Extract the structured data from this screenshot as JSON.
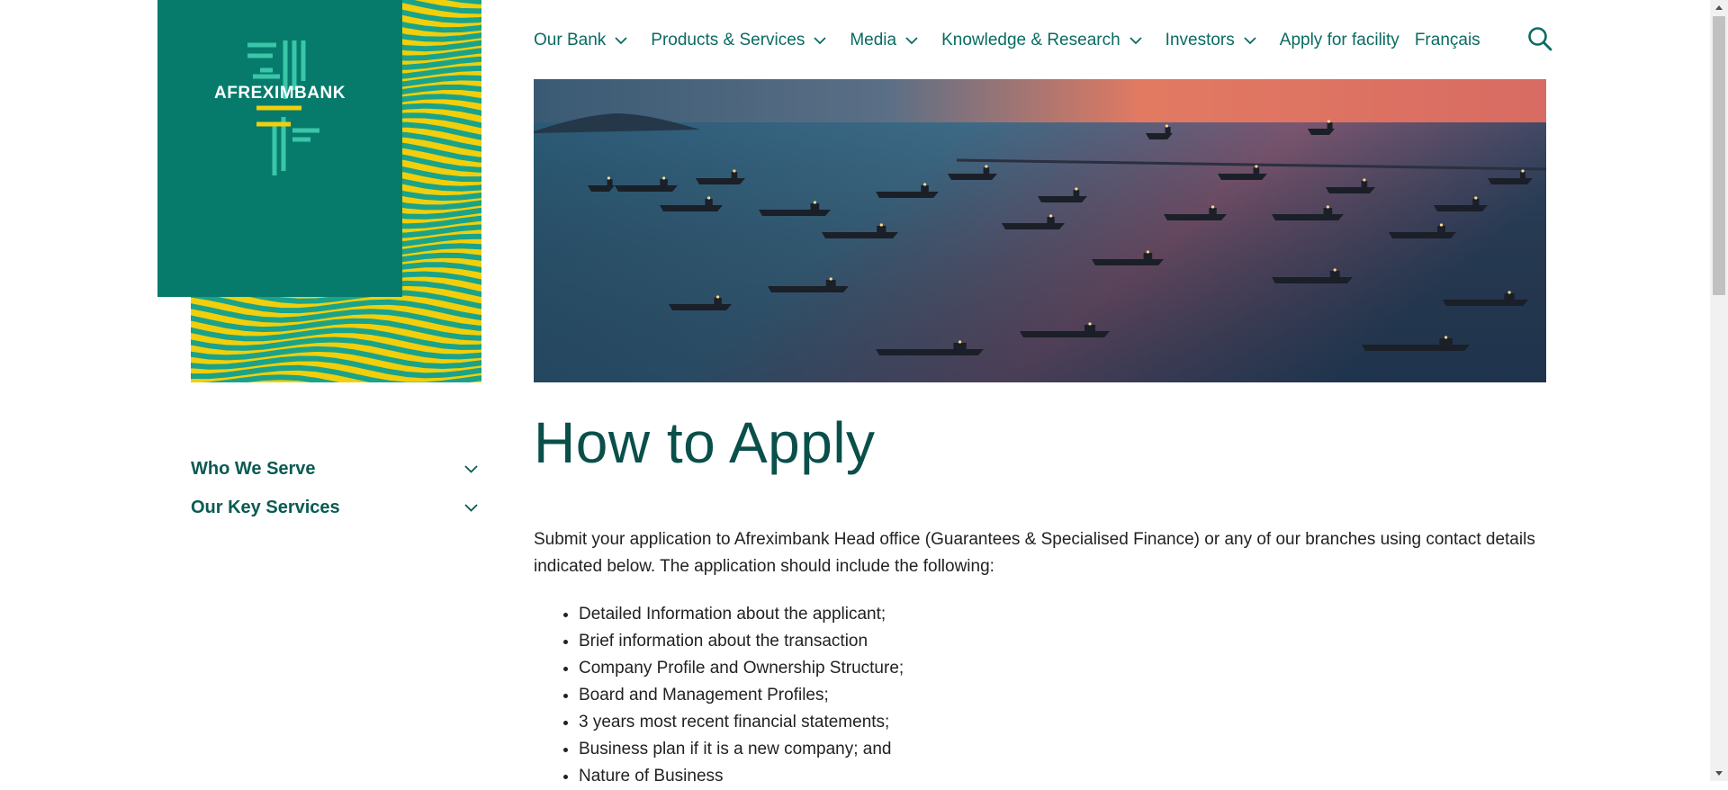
{
  "brand": {
    "name": "AFREXIMBANK"
  },
  "nav": {
    "items": [
      {
        "label": "Our Bank",
        "dropdown": true
      },
      {
        "label": "Products & Services",
        "dropdown": true
      },
      {
        "label": "Media",
        "dropdown": true
      },
      {
        "label": "Knowledge & Research",
        "dropdown": true
      },
      {
        "label": "Investors",
        "dropdown": true
      },
      {
        "label": "Apply for facility",
        "dropdown": false
      },
      {
        "label": "Français",
        "dropdown": false
      }
    ],
    "search_icon": "search-icon"
  },
  "sidebar": {
    "items": [
      {
        "label": "Who We Serve"
      },
      {
        "label": "Our Key Services"
      }
    ]
  },
  "main": {
    "title": "How to Apply",
    "intro": "Submit your application to Afreximbank Head office (Guarantees & Specialised Finance) or any of our branches using contact details indicated below. The application should include the following:",
    "requirements": [
      "Detailed Information about the applicant;",
      "Brief information about the transaction",
      "Company Profile and Ownership Structure;",
      "Board and Management Profiles;",
      "3 years most recent financial statements;",
      "Business plan if it is a new company; and",
      "Nature of Business"
    ]
  },
  "colors": {
    "brand_green": "#067b6c",
    "brand_yellow": "#f2cf0a",
    "nav_text": "#0a6b62",
    "heading": "#0a4f4a"
  }
}
